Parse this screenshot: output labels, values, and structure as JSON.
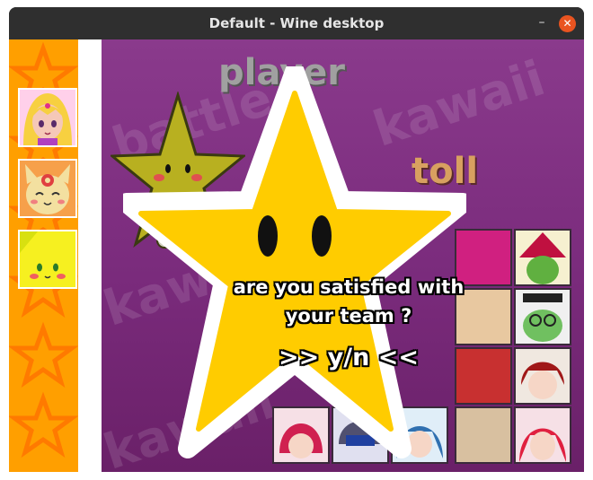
{
  "window": {
    "title": "Default - Wine desktop",
    "minimize_glyph": "–",
    "close_glyph": "✕"
  },
  "game": {
    "header_word": "player",
    "bg_words": [
      "kawaii",
      "battle",
      "kawaii",
      "battle",
      "kawaii"
    ],
    "question_line1": "are you satisfied with",
    "question_line2": "your team ?",
    "choice": ">> y/n <<",
    "team_slots": [
      {
        "name": "slot-1",
        "character": "pink-haired-girl"
      },
      {
        "name": "slot-2",
        "character": "orange-cat"
      },
      {
        "name": "slot-3",
        "character": "yellow-blob"
      }
    ]
  },
  "colors": {
    "star_fill": "#ffcc00",
    "star_outline": "#ffffff",
    "left_strip": "#ff9f00",
    "purple_bg": "#7a2b7c",
    "close_button": "#e95420"
  }
}
